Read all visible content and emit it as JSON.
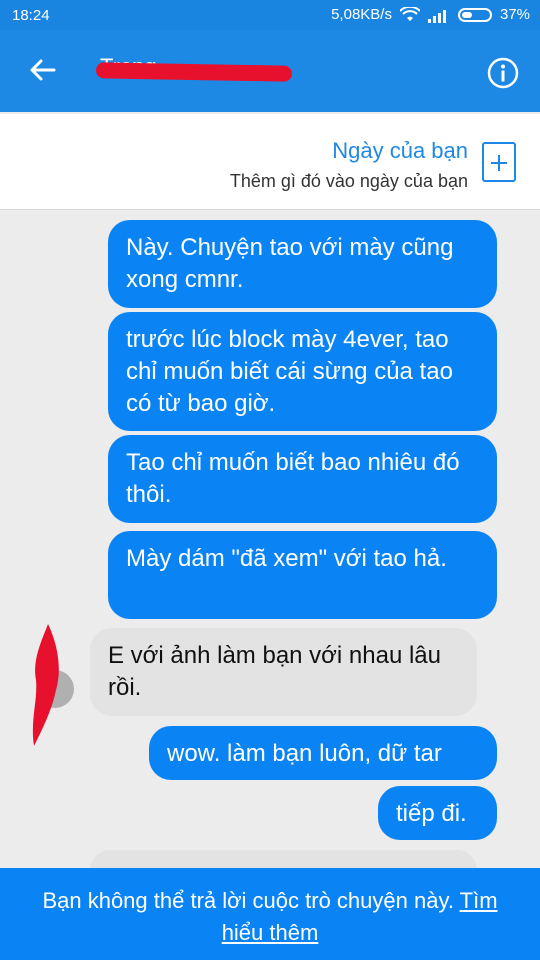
{
  "status_bar": {
    "time": "18:24",
    "network_speed": "5,08KB/s",
    "battery": "37%",
    "battery_level": 0.37,
    "icons": [
      "wifi-icon",
      "signal-icon",
      "battery-icon"
    ]
  },
  "header": {
    "back_icon": "arrow-left-icon",
    "contact_name": "Trang",
    "info_icon": "info-icon"
  },
  "banner": {
    "title": "Ngày của bạn",
    "subtitle": "Thêm gì đó vào ngày của bạn",
    "add_icon": "plus-square-icon"
  },
  "messages": [
    {
      "direction": "out",
      "text": "Này. Chuyện tao với mày cũng xong cmnr."
    },
    {
      "direction": "out",
      "text": "trước lúc block mày 4ever, tao chỉ muốn biết cái sừng của tao có từ bao giờ."
    },
    {
      "direction": "out",
      "text": "Tao chỉ muốn biết bao nhiêu đó thôi."
    },
    {
      "direction": "out",
      "text": "Mày dám \"đã xem\" với tao hả."
    },
    {
      "direction": "in",
      "text": "E với ảnh làm bạn với nhau lâu rồi."
    },
    {
      "direction": "out",
      "text": "wow. làm bạn luôn, dữ tar"
    },
    {
      "direction": "out",
      "text": "tiếp đi."
    }
  ],
  "footer": {
    "notice": "Bạn không thể trả lời cuộc trò chuyện này.",
    "link": "Tìm hiểu thêm"
  },
  "colors": {
    "primary": "#1e88e5",
    "outgoing_bubble": "#0a84f5",
    "incoming_bubble": "#e3e3e3",
    "redaction": "#e8112d"
  }
}
